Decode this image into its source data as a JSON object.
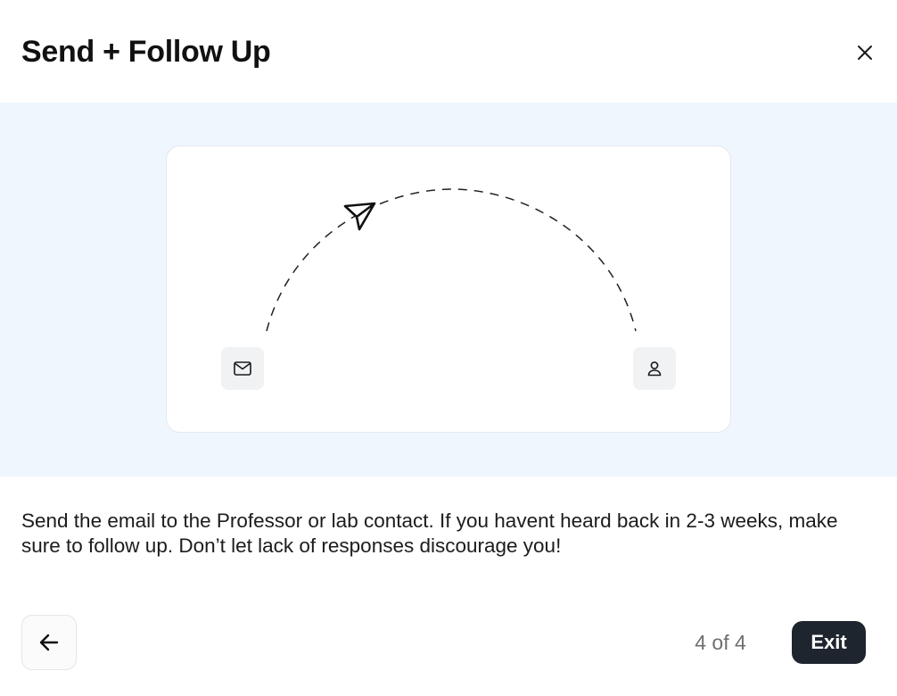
{
  "header": {
    "title": "Send + Follow Up",
    "close_icon": "close-icon"
  },
  "illustration": {
    "icons": [
      "mail-icon",
      "send-plane-icon",
      "user-icon"
    ],
    "path_style": "dashed-arc"
  },
  "body": {
    "description": "Send the email to the Professor or lab contact. If you havent heard back in 2-3 weeks, make sure to follow up. Don’t let lack of responses discourage you!"
  },
  "footer": {
    "back_icon": "arrow-left-icon",
    "step_counter": "4 of 4",
    "exit_label": "Exit"
  },
  "colors": {
    "illustration_bg": "#eff6fe",
    "exit_button_bg": "#1e252e",
    "title_text": "#111111"
  }
}
